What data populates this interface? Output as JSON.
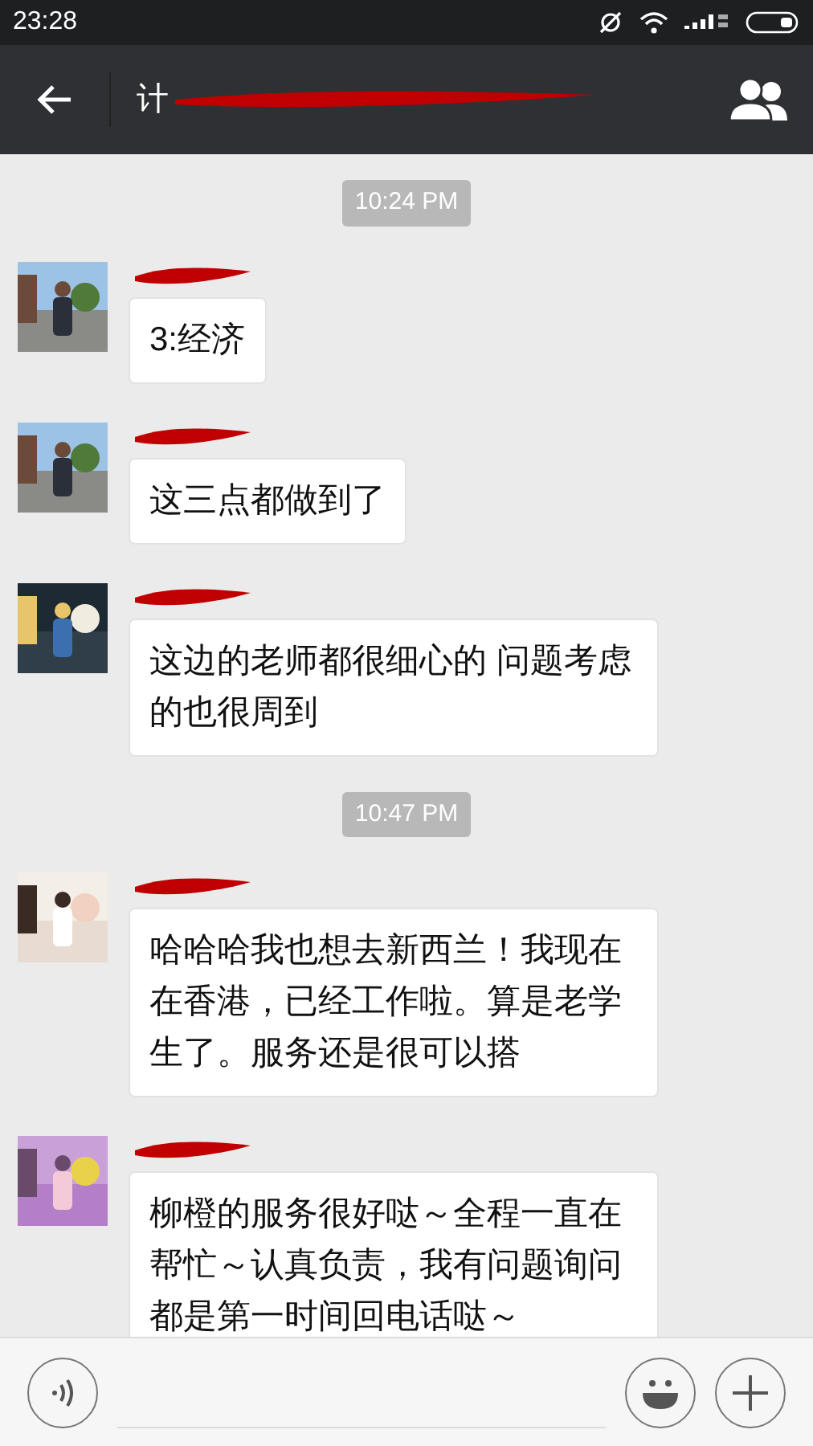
{
  "status_bar": {
    "time": "23:28"
  },
  "header": {
    "title": "计"
  },
  "messages": [
    {
      "kind": "time",
      "text": "10:24 PM"
    },
    {
      "kind": "message",
      "text": "3:经济"
    },
    {
      "kind": "message",
      "text": "这三点都做到了"
    },
    {
      "kind": "message",
      "text": "这边的老师都很细心的 问题考虑的也很周到"
    },
    {
      "kind": "time",
      "text": "10:47 PM"
    },
    {
      "kind": "message",
      "text": "哈哈哈我也想去新西兰！我现在在香港，已经工作啦。算是老学生了。服务还是很可以搭"
    },
    {
      "kind": "message",
      "text": "柳橙的服务很好哒～全程一直在帮忙～认真负责，我有问题询问都是第一时间回电话哒～"
    }
  ]
}
